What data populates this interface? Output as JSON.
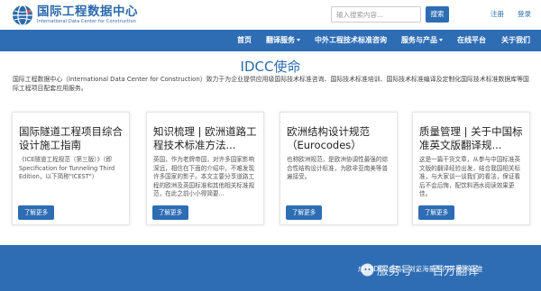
{
  "header": {
    "logo_title": "国际工程数据中心",
    "logo_subtitle": "International Data Center for Construction",
    "search_placeholder": "输入搜索内容...",
    "search_button": "搜索",
    "register": "注册",
    "login": "登录"
  },
  "nav": {
    "items": [
      {
        "label": "首页"
      },
      {
        "label": "翻译服务"
      },
      {
        "label": "中外工程技术标准咨询"
      },
      {
        "label": "服务与产品"
      },
      {
        "label": "在线平台"
      },
      {
        "label": "关于我们"
      }
    ]
  },
  "mission": {
    "title": "IDCC使命",
    "text": "国际工程数据中心（International Data Center for Construction）致力于为企业提供应用级国际技术标准咨询、国际技术标准培训、国际技术标准编译及定制化国际技术标准数据库等国际工程项目配套应用服务。"
  },
  "cards": [
    {
      "title": "国际隧道工程项目综合设计施工指南",
      "text": "《ICE隧道工程规范（第三版）》（即Specification for Tunneling Third Edition，以下简称\"ICEST\"）",
      "button": "了解更多"
    },
    {
      "title": "知识梳理 | 欧洲道路工程技术标准方法...",
      "text": "英国，作为老牌帝国，对许多国家影响深远，相信在下面的介绍中，不难发现许多国家的影子。本文主要分享道路工程的欧洲及英国标准和其他相关标准规范，在此之前小小得简要...",
      "button": "了解更多"
    },
    {
      "title": "欧洲结构设计规范（Eurocodes）",
      "text": "也称欧洲规范，是欧洲协调性最强的综合性结构设计标准，为欧非亚南美等普遍接受。",
      "button": "了解更多"
    },
    {
      "title": "质量管理 | 关于中国标准英文版翻译规...",
      "text": "这是一篇干货文章，从参与中国标准英文版的翻译经验出发，结合我国相关标准，与大家谈一谈我们的看法，保证看后不会后悔，配饮料酒水阅读效果更佳。",
      "button": "了解更多"
    }
  ],
  "banner": {
    "text": "成为IDCC会员，浏览海量国内外技术标准"
  },
  "watermark": {
    "text1": "服务号 ·",
    "text2": "百万翻译"
  },
  "colors": {
    "brand_blue": "#2e6db4",
    "title_blue": "#2b6aab"
  }
}
